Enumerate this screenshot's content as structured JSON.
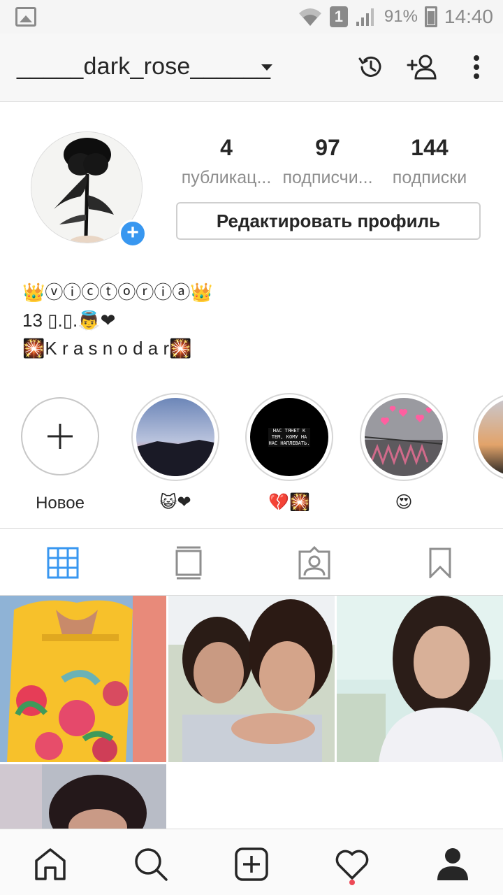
{
  "status_bar": {
    "sim_label": "1",
    "battery_percent": "91%",
    "time": "14:40"
  },
  "header": {
    "username": "_____dark_rose______",
    "icons": [
      "history-icon",
      "add-person-icon",
      "more-vertical-icon"
    ]
  },
  "profile": {
    "stats": [
      {
        "value": "4",
        "label": "публикац..."
      },
      {
        "value": "97",
        "label": "подписчи..."
      },
      {
        "value": "144",
        "label": "подписки"
      }
    ],
    "edit_button_label": "Редактировать профиль",
    "bio": [
      "👑ⓥⓘⓒⓣⓞⓡⓘⓐ👑",
      "13 ▯.▯.👼❤",
      "🎇K r a s n o d a r🎇"
    ]
  },
  "highlights": [
    {
      "caption": "Новое",
      "type": "new"
    },
    {
      "caption": "😺❤",
      "type": "story"
    },
    {
      "caption": "💔🎇",
      "type": "story"
    },
    {
      "caption": "😍",
      "type": "story"
    }
  ],
  "highlight_text": "НАС ТЯНЕТ К ТЕМ, КОМУ НА НАС НАПЛЕВАТЬ.",
  "tabs": [
    "grid-icon",
    "feed-icon",
    "tagged-icon",
    "saved-icon"
  ],
  "bottom_nav": [
    "home-icon",
    "search-icon",
    "add-post-icon",
    "activity-icon",
    "profile-icon"
  ],
  "colors": {
    "accent_blue": "#3897f0",
    "active_tab": "#3897f0",
    "notification_dot": "#ed4956"
  }
}
